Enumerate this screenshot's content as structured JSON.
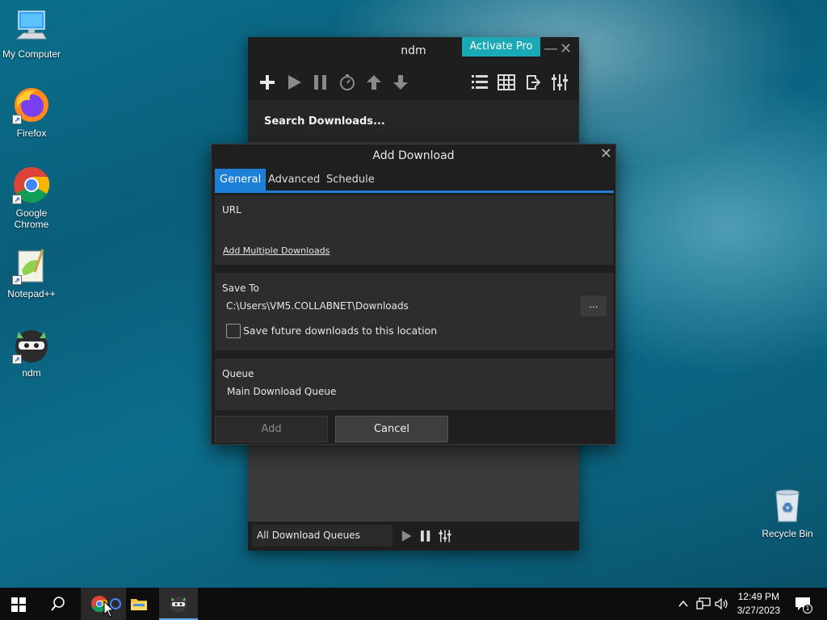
{
  "desktop": {
    "icons": [
      {
        "label": "My Computer"
      },
      {
        "label": "Firefox"
      },
      {
        "label": "Google Chrome"
      },
      {
        "label": "Notepad++"
      },
      {
        "label": "ndm"
      }
    ],
    "recycle_bin": {
      "label": "Recycle Bin"
    }
  },
  "ndm": {
    "title": "ndm",
    "activate_label": "Activate Pro",
    "toolbar_icons": [
      "add-icon",
      "play-icon",
      "pause-icon",
      "timer-icon",
      "move-up-icon",
      "move-down-icon",
      "list-view-icon",
      "grid-view-icon",
      "export-icon",
      "settings-sliders-icon"
    ],
    "search_placeholder": "Search Downloads...",
    "bottom": {
      "queue_selected": "All Download Queues"
    }
  },
  "dialog": {
    "title": "Add Download",
    "tabs": [
      {
        "label": "General",
        "active": true
      },
      {
        "label": "Advanced",
        "active": false
      },
      {
        "label": "Schedule",
        "active": false
      }
    ],
    "url_label": "URL",
    "url_value": "",
    "multiple_link": "Add Multiple Downloads",
    "save_to_label": "Save To",
    "save_path": "C:\\Users\\VM5.COLLABNET\\Downloads",
    "browse_label": "...",
    "remember_label": "Save future downloads to this location",
    "remember_checked": false,
    "queue_label": "Queue",
    "queue_value": "Main Download Queue",
    "add_label": "Add",
    "cancel_label": "Cancel"
  },
  "taskbar": {
    "time": "12:49 PM",
    "date": "3/27/2023",
    "notification_count": "1"
  },
  "colors": {
    "accent": "#1e7fd6",
    "activate": "#1aa9b5",
    "window_bg": "#1e1e1e"
  }
}
